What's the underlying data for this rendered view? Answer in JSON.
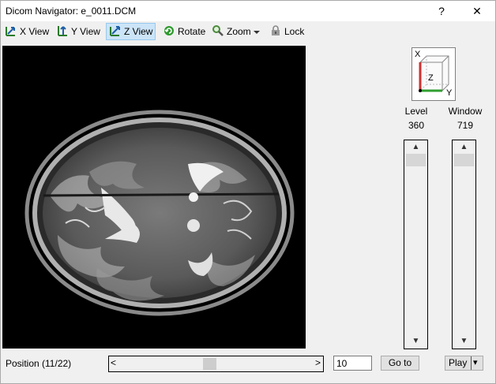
{
  "window": {
    "title": "Dicom Navigator: e_0011.DCM",
    "help": "?",
    "close": "✕"
  },
  "toolbar": {
    "x_view": "X View",
    "y_view": "Y View",
    "z_view": "Z View",
    "rotate": "Rotate",
    "zoom": "Zoom",
    "lock": "Lock"
  },
  "orientation_cube": {
    "x": "X",
    "y": "Y",
    "z": "Z"
  },
  "level": {
    "label": "Level",
    "value": "360"
  },
  "window_ctrl": {
    "label": "Window",
    "value": "719"
  },
  "scroll": {
    "up": "▲",
    "down": "▼",
    "left": "<",
    "right": ">"
  },
  "status": {
    "position": "Position (11/22)"
  },
  "goto": {
    "value": "10",
    "label": "Go to"
  },
  "play": {
    "label": "Play",
    "dropdown": "▾"
  },
  "colors": {
    "active_tool": "#cce4f7",
    "x_axis": "#d03030",
    "y_axis": "#30a030"
  }
}
